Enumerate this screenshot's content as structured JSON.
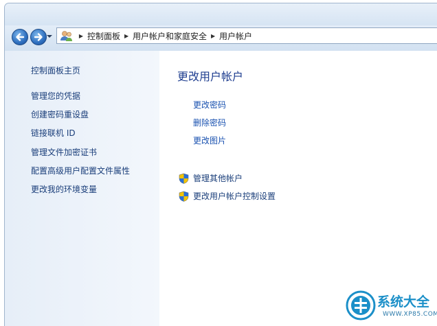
{
  "address_bar": {
    "crumbs": [
      "控制面板",
      "用户帐户和家庭安全",
      "用户帐户"
    ]
  },
  "sidebar": {
    "items": [
      {
        "label": "控制面板主页"
      },
      {
        "label": "管理您的凭据"
      },
      {
        "label": "创建密码重设盘"
      },
      {
        "label": "链接联机 ID"
      },
      {
        "label": "管理文件加密证书"
      },
      {
        "label": "配置高级用户配置文件属性"
      },
      {
        "label": "更改我的环境变量"
      }
    ]
  },
  "main": {
    "title": "更改用户帐户",
    "tasks": [
      {
        "label": "更改密码"
      },
      {
        "label": "删除密码"
      },
      {
        "label": "更改图片"
      }
    ],
    "admin_tasks": [
      {
        "label": "管理其他帐户",
        "icon": "shield-icon"
      },
      {
        "label": "更改用户帐户控制设置",
        "icon": "shield-icon"
      }
    ]
  },
  "watermark": {
    "title": "系统大全",
    "url": "WWW.XP85.COM"
  },
  "colors": {
    "link": "#1a52b0",
    "title": "#1e3d8f",
    "sidebar_link": "#1a3e7a",
    "watermark": "#1b8fc8"
  }
}
